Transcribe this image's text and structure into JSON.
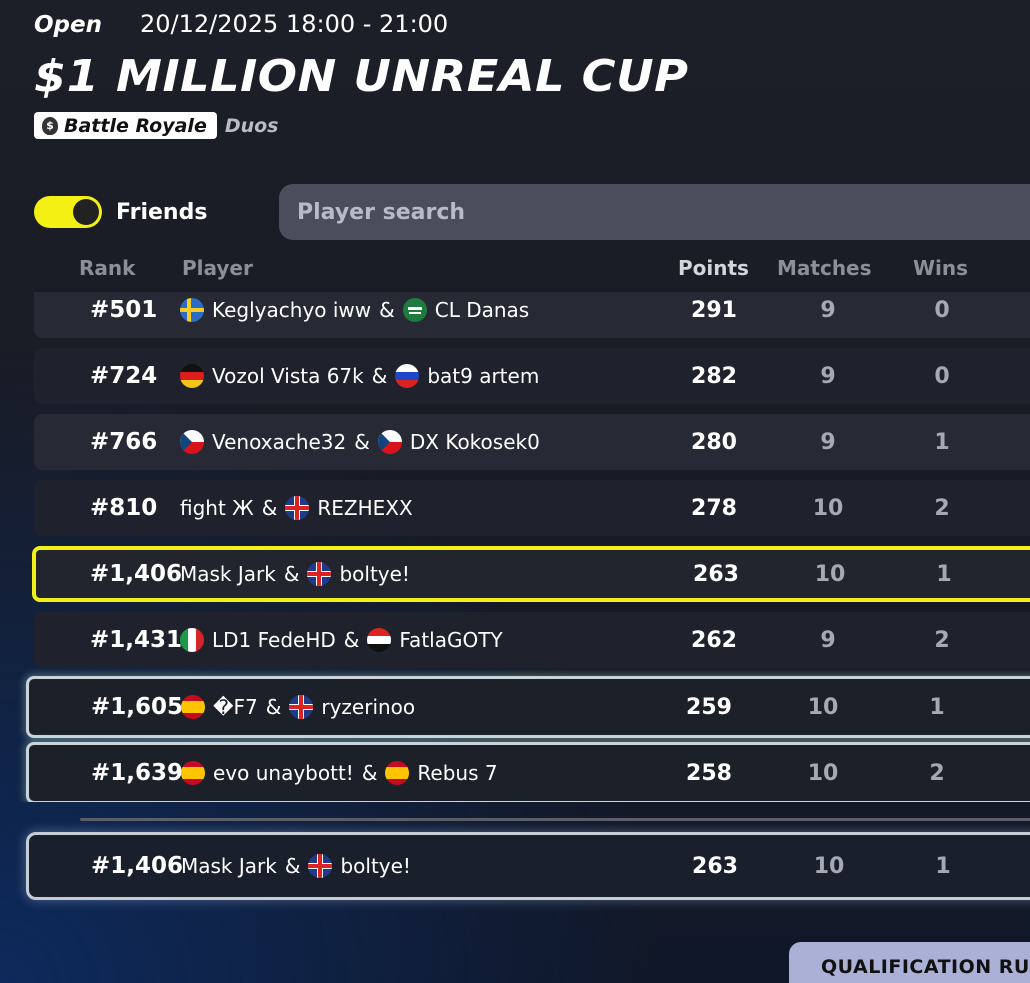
{
  "header": {
    "status": "Open",
    "datetime": "20/12/2025 18:00 - 21:00",
    "title": "$1 MILLION UNREAL CUP",
    "mode_tag": "Battle Royale",
    "team_size": "Duos",
    "mode_icon": "moneybag-icon"
  },
  "filters": {
    "friends_label": "Friends",
    "friends_toggle_on": true,
    "search_placeholder": "Player search"
  },
  "columns": {
    "rank": "Rank",
    "player": "Player",
    "points": "Points",
    "matches": "Matches",
    "wins": "Wins"
  },
  "rows": [
    {
      "rank": "#501",
      "p1_flag": "sweden",
      "p1": "Keglyachyo iww",
      "p2_flag": "saudi-arabia",
      "p2": "CL Danas",
      "points": "291",
      "matches": "9",
      "wins": "0"
    },
    {
      "rank": "#724",
      "p1_flag": "germany",
      "p1": "Vozol Vista 67k",
      "p2_flag": "russia",
      "p2": "bat9 artem",
      "points": "282",
      "matches": "9",
      "wins": "0"
    },
    {
      "rank": "#766",
      "p1_flag": "czechia",
      "p1": "Venoxache32",
      "p2_flag": "czechia",
      "p2": "DX Kokosek0",
      "points": "280",
      "matches": "9",
      "wins": "1"
    },
    {
      "rank": "#810",
      "p1_flag": "",
      "p1": "fight Ж",
      "p2_flag": "uk",
      "p2": "REZHEXX",
      "points": "278",
      "matches": "10",
      "wins": "2"
    },
    {
      "rank": "#1,406",
      "p1_flag": "",
      "p1": "Mask Jark",
      "p2_flag": "uk",
      "p2": "boltye!",
      "points": "263",
      "matches": "10",
      "wins": "1"
    },
    {
      "rank": "#1,431",
      "p1_flag": "italy",
      "p1": "LD1 FedeHD",
      "p2_flag": "egypt",
      "p2": "FatlaGOTY",
      "points": "262",
      "matches": "9",
      "wins": "2"
    },
    {
      "rank": "#1,605",
      "p1_flag": "spain",
      "p1": "�F7",
      "p2_flag": "uk",
      "p2": "ryzerinoo",
      "points": "259",
      "matches": "10",
      "wins": "1"
    },
    {
      "rank": "#1,639",
      "p1_flag": "spain",
      "p1": "evo unaybott!",
      "p2_flag": "spain",
      "p2": "Rebus 7",
      "points": "258",
      "matches": "10",
      "wins": "2"
    }
  ],
  "my_team": {
    "rank": "#1,406",
    "p1": "Mask Jark",
    "p2_flag": "uk",
    "p2": "boltye!",
    "points": "263",
    "matches": "10",
    "wins": "1"
  },
  "footer": {
    "qualification_button": "QUALIFICATION RU"
  },
  "colors": {
    "accent_yellow": "#f2ef1a",
    "search_bg": "#4a4e5c",
    "button_bg": "#aab0d6"
  }
}
